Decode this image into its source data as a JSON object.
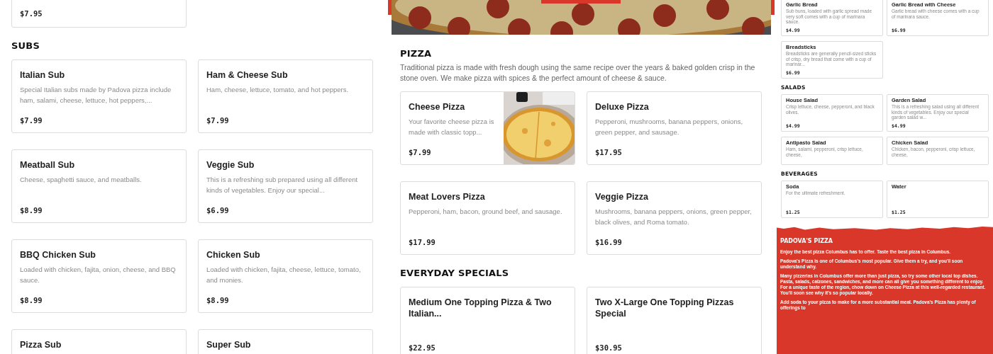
{
  "left_column": {
    "sections": [
      {
        "items": [
          {
            "kind": "partial",
            "price": "$7.95"
          }
        ]
      },
      {
        "title": "SUBS",
        "items": [
          {
            "kind": "text",
            "name": "Italian Sub",
            "description": "Special Italian subs made by Padova pizza include ham, salami, cheese, lettuce, hot peppers,...",
            "price": "$7.99"
          },
          {
            "kind": "text",
            "name": "Ham & Cheese Sub",
            "description": "Ham, cheese, lettuce, tomato, and hot peppers.",
            "price": "$7.99"
          },
          {
            "kind": "text",
            "name": "Meatball Sub",
            "description": "Cheese, spaghetti sauce, and meatballs.",
            "price": "$8.99"
          },
          {
            "kind": "text",
            "name": "Veggie Sub",
            "description": "This is a refreshing sub prepared using all different kinds of vegetables. Enjoy our special...",
            "price": "$6.99"
          },
          {
            "kind": "text",
            "name": "BBQ Chicken Sub",
            "description": "Loaded with chicken, fajita, onion, cheese, and BBQ sauce.",
            "price": "$8.99"
          },
          {
            "kind": "text",
            "name": "Chicken Sub",
            "description": "Loaded with chicken, fajita, cheese, lettuce, tomato, and monies.",
            "price": "$8.99"
          },
          {
            "kind": "text",
            "name": "Pizza Sub"
          },
          {
            "kind": "text",
            "name": "Super Sub"
          }
        ]
      }
    ]
  },
  "middle_column": {
    "sections": [
      {
        "title": "PIZZA",
        "description": "Traditional pizza is made with fresh dough using the same recipe over the years & baked golden crisp in the stone oven. We make pizza with spices & the perfect amount of cheese & sauce.",
        "items": [
          {
            "name": "Cheese Pizza",
            "description": "Your favorite cheese pizza is made with classic topp...",
            "price": "$7.99"
          },
          {
            "kind": "text",
            "name": "Deluxe Pizza",
            "description": "Pepperoni, mushrooms, banana peppers, onions, green pepper, and sausage.",
            "price": "$17.95"
          },
          {
            "kind": "text",
            "name": "Meat Lovers Pizza",
            "description": "Pepperoni, ham, bacon, ground beef, and sausage.",
            "price": "$17.99"
          },
          {
            "kind": "text",
            "name": "Veggie Pizza",
            "description": "Mushrooms, banana peppers, onions, green pepper, black olives, and Roma tomato.",
            "price": "$16.99"
          }
        ]
      },
      {
        "title": "EVERYDAY SPECIALS",
        "items": [
          {
            "kind": "text",
            "name": "Medium One Topping Pizza & Two Italian...",
            "price": "$22.95"
          },
          {
            "kind": "text",
            "name": "Two X-Large One Topping Pizzas Special",
            "price": "$30.95"
          }
        ]
      }
    ]
  },
  "right_column": {
    "sections": [
      {
        "items": [
          {
            "kind": "text",
            "name": "Garlic Bread",
            "description": "Sub buns, loaded with garlic spread made very soft comes with a cup of marinara sauce.",
            "price": "$4.99"
          },
          {
            "kind": "text",
            "name": "Garlic Bread with Cheese",
            "description": "Garlic bread with cheese comes with a cup of marinara sauce.",
            "price": "$6.99"
          },
          {
            "kind": "text",
            "name": "Breadsticks",
            "description": "Breadsticks are generally pencil-sized sticks of crisp, dry bread that come with a cup of marinar...",
            "price": "$6.99"
          }
        ]
      },
      {
        "title": "SALADS",
        "items": [
          {
            "kind": "text",
            "name": "House Salad",
            "description": "Crisp lettuce, cheese, pepperoni, and black olives.",
            "price": "$4.99"
          },
          {
            "kind": "text",
            "name": "Garden Salad",
            "description": "This is a refreshing salad using all different kinds of vegetables. Enjoy our special garden salad w...",
            "price": "$4.99"
          },
          {
            "kind": "partial",
            "name": "Antipasto Salad",
            "description": "Ham, salami, pepperoni, crisp lettuce, cheese,"
          },
          {
            "kind": "partial",
            "name": "Chicken Salad",
            "description": "Chicken, bacon, pepperoni, crisp lettuce, cheese,"
          }
        ]
      },
      {
        "title": "BEVERAGES",
        "items": [
          {
            "kind": "text",
            "name": "Soda",
            "description": "For the ultimate refreshment.",
            "price": "$1.25"
          },
          {
            "kind": "text",
            "name": "Water",
            "price": "$1.25"
          }
        ]
      }
    ],
    "footer": {
      "title": "PADOVA'S PIZZA",
      "paragraphs": [
        "Enjoy the best pizza Columbus has to offer. Taste the best pizza in Columbus.",
        "Padova's Pizza is one of Columbus's most popular. Give them a try, and you'll soon understand why.",
        "Many pizzerias in Columbus offer more than just pizza, so try some other local top dishes. Pasta, salads, calzones, sandwiches, and more can all give you something different to enjoy. For a unique taste of the region, chow down on Cheese Pizza at this well-regarded restaurant. You'll soon see why it's so popular locally.",
        "Add soda to your pizza to make for a more substantial meal. Padova's Pizza has plenty of offerings to"
      ]
    }
  }
}
